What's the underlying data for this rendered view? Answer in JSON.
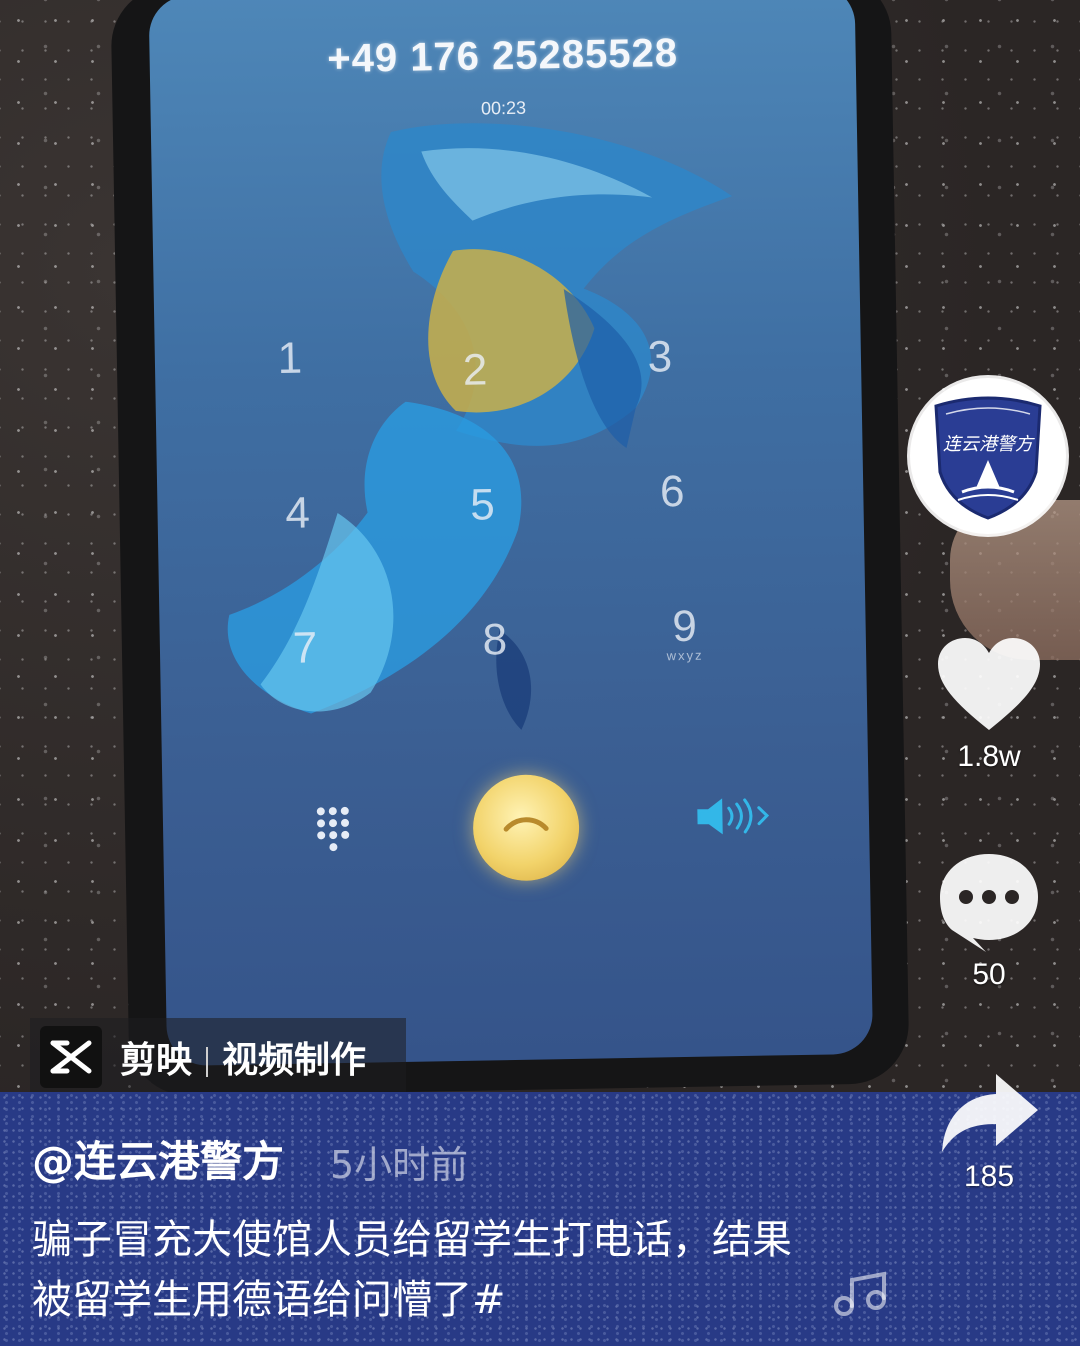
{
  "call": {
    "number": "+49 176 25285528",
    "timer": "00:23",
    "keys": [
      {
        "digit": "1",
        "sub": ""
      },
      {
        "digit": "2",
        "sub": ""
      },
      {
        "digit": "3",
        "sub": ""
      },
      {
        "digit": "4",
        "sub": ""
      },
      {
        "digit": "5",
        "sub": ""
      },
      {
        "digit": "6",
        "sub": ""
      },
      {
        "digit": "7",
        "sub": ""
      },
      {
        "digit": "8",
        "sub": ""
      },
      {
        "digit": "9",
        "sub": "wxyz"
      }
    ],
    "hangup_color": "#f2d36a",
    "speaker_color": "#33b7e8"
  },
  "account": {
    "avatar_text": "连云港警方",
    "avatar_color": "#2a3d94"
  },
  "actions": {
    "likes": "1.8w",
    "comments": "50",
    "shares": "185"
  },
  "watermark": {
    "app": "剪映",
    "label": "视频制作"
  },
  "post": {
    "author": "@连云港警方",
    "time_ago": "5小时前",
    "caption": "骗子冒充大使馆人员给留学生打电话，结果被留学生用德语给问懵了#"
  },
  "colors": {
    "caption_band": "#283a86",
    "text": "#ffffff"
  }
}
